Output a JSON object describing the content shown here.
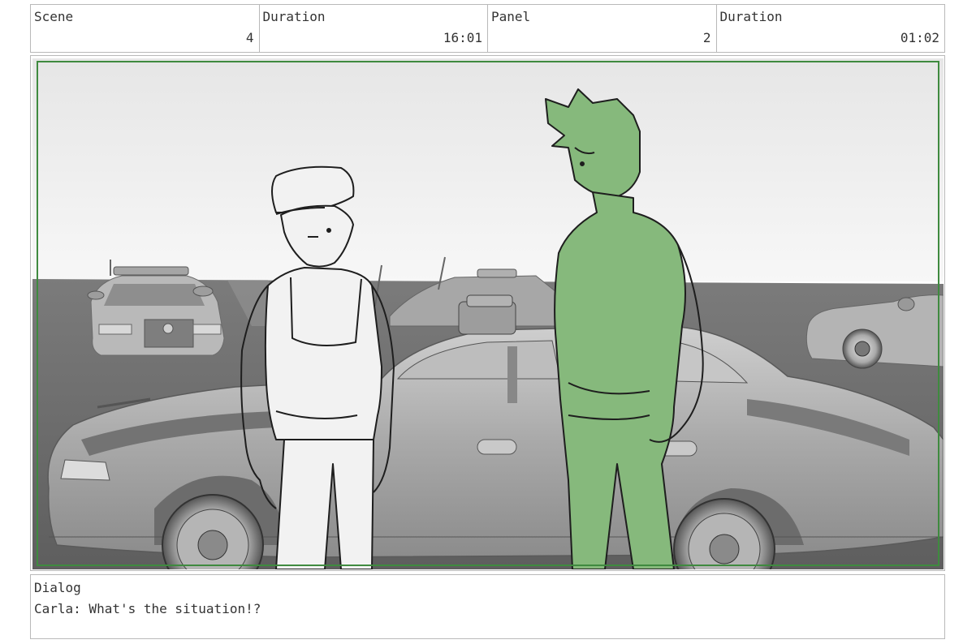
{
  "header": {
    "scene_label": "Scene",
    "scene_value": "4",
    "scene_duration_label": "Duration",
    "scene_duration_value": "16:01",
    "panel_label": "Panel",
    "panel_value": "2",
    "panel_duration_label": "Duration",
    "panel_duration_value": "01:02"
  },
  "dialog": {
    "title": "Dialog",
    "text": "Carla: What's the situation!?"
  },
  "colors": {
    "frame_green": "#3f8a3f",
    "character_green": "#86b97c",
    "border_gray": "#b9b9b9"
  }
}
